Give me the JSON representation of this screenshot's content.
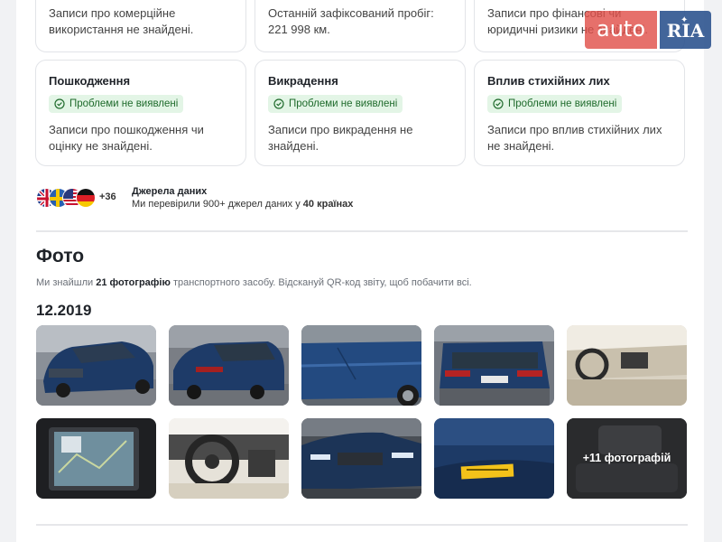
{
  "cards_top": [
    {
      "text": "Записи про комерційне використання не знайдені."
    },
    {
      "text": "Останній зафіксований пробіг: 221 998 км."
    },
    {
      "text": "Записи про фінансові чи юридичні ризики не знайдені."
    }
  ],
  "cards": [
    {
      "title": "Пошкодження",
      "badge": "Проблеми не виявлені",
      "text": "Записи про пошкодження чи оцінку не знайдені."
    },
    {
      "title": "Викрадення",
      "badge": "Проблеми не виявлені",
      "text": "Записи про викрадення не знайдені."
    },
    {
      "title": "Вплив стихійних лих",
      "badge": "Проблеми не виявлені",
      "text": "Записи про вплив стихійних лих не знайдені."
    }
  ],
  "sources": {
    "more_count": "+36",
    "title": "Джерела даних",
    "text_prefix": "Ми перевірили 900+ джерел даних у",
    "text_bold": "40 країнах",
    "flags": [
      "uk-flag-icon",
      "sweden-flag-icon",
      "usa-flag-icon",
      "germany-flag-icon"
    ]
  },
  "photos": {
    "title": "Фото",
    "desc_prefix": "Ми знайшли",
    "desc_bold": "21 фотографію",
    "desc_suffix": "транспортного засобу. Відскануй QR-код звіту, щоб побачити всі.",
    "date": "12.2019",
    "more_label": "+11 фотографій"
  },
  "logo": {
    "part1": "auto",
    "part2": "RIA"
  },
  "colors": {
    "badge_bg": "#e3f5e6",
    "badge_text": "#1f6b2c",
    "car_blue": "#1d3a66"
  }
}
